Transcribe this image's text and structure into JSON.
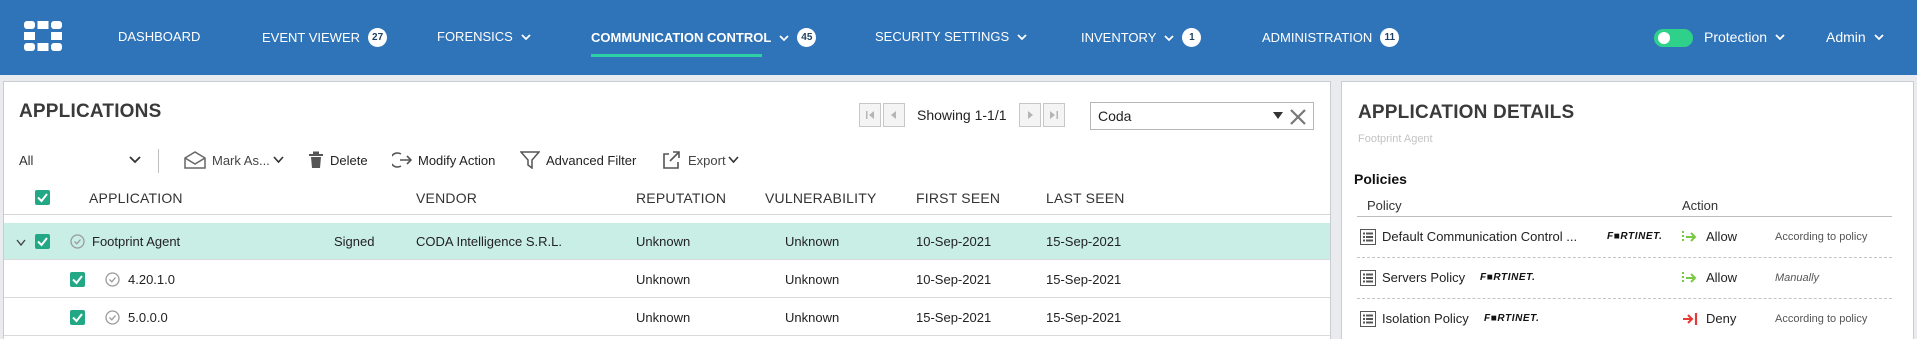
{
  "nav": {
    "logo": "fortinet-logo-icon",
    "items": [
      {
        "label": "DASHBOARD",
        "badge": null,
        "dropdown": false
      },
      {
        "label": "EVENT VIEWER",
        "badge": "27",
        "dropdown": false
      },
      {
        "label": "FORENSICS",
        "badge": null,
        "dropdown": true
      },
      {
        "label": "COMMUNICATION CONTROL",
        "badge": "45",
        "dropdown": true
      },
      {
        "label": "SECURITY SETTINGS",
        "badge": null,
        "dropdown": true
      },
      {
        "label": "INVENTORY",
        "badge": "1",
        "dropdown": true
      },
      {
        "label": "ADMINISTRATION",
        "badge": "11",
        "dropdown": false
      }
    ],
    "active_index": 3,
    "protection_label": "Protection",
    "user_label": "Admin"
  },
  "applications": {
    "title": "APPLICATIONS",
    "paging_text": "Showing 1-1/1",
    "search_value": "Coda",
    "filter_value": "All",
    "toolbar": {
      "mark_as": "Mark As...",
      "delete": "Delete",
      "modify_action": "Modify Action",
      "advanced_filter": "Advanced Filter",
      "export": "Export"
    },
    "columns": {
      "application": "APPLICATION",
      "vendor": "VENDOR",
      "reputation": "REPUTATION",
      "vulnerability": "VULNERABILITY",
      "first_seen": "FIRST SEEN",
      "last_seen": "LAST SEEN"
    },
    "rows": [
      {
        "name": "Footprint Agent",
        "signed": "Signed",
        "vendor": "CODA Intelligence S.R.L.",
        "reputation": "Unknown",
        "vulnerability": "Unknown",
        "first_seen": "10-Sep-2021",
        "last_seen": "15-Sep-2021"
      },
      {
        "name": "4.20.1.0",
        "signed": "",
        "vendor": "",
        "reputation": "Unknown",
        "vulnerability": "Unknown",
        "first_seen": "10-Sep-2021",
        "last_seen": "15-Sep-2021"
      },
      {
        "name": "5.0.0.0",
        "signed": "",
        "vendor": "",
        "reputation": "Unknown",
        "vulnerability": "Unknown",
        "first_seen": "15-Sep-2021",
        "last_seen": "15-Sep-2021"
      }
    ]
  },
  "details": {
    "title": "APPLICATION DETAILS",
    "subtitle": "Footprint Agent",
    "policies_label": "Policies",
    "columns": {
      "policy": "Policy",
      "action": "Action"
    },
    "vendor_mark": "F■RTINET.",
    "policies": [
      {
        "name": "Default Communication Control ...",
        "action": "Allow",
        "note": "According to policy"
      },
      {
        "name": "Servers Policy",
        "action": "Allow",
        "note": "Manually"
      },
      {
        "name": "Isolation Policy",
        "action": "Deny",
        "note": "According to policy"
      }
    ]
  },
  "colors": {
    "nav_bg": "#2f73b8",
    "active_underline": "#2fd1a4",
    "toggle_on": "#2fd18a",
    "checkbox": "#22a884",
    "selected_row": "#c9eee6",
    "allow": "#7ac943",
    "deny": "#e53935"
  }
}
